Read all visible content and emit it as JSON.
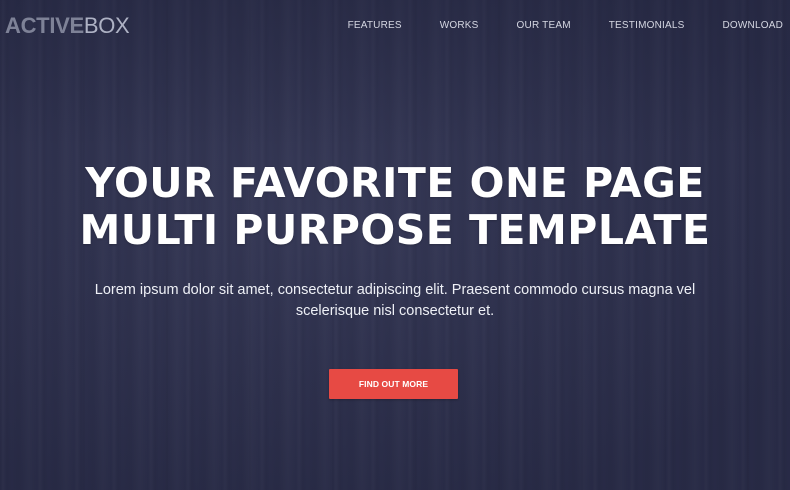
{
  "brand": {
    "logo_strong": "ACTIVE",
    "logo_light": "BOX"
  },
  "nav": {
    "items": [
      {
        "label": "FEATURES"
      },
      {
        "label": "WORKS"
      },
      {
        "label": "OUR TEAM"
      },
      {
        "label": "TESTIMONIALS"
      },
      {
        "label": "DOWNLOAD"
      }
    ]
  },
  "hero": {
    "title_line1": "YOUR FAVORITE ONE PAGE",
    "title_line2": "MULTI PURPOSE TEMPLATE",
    "subtitle": "Lorem ipsum dolor sit amet, consectetur adipiscing elit. Praesent commodo cursus magna vel scelerisque nisl consectetur et.",
    "cta_label": "FIND OUT MORE"
  },
  "colors": {
    "background": "#2e3150",
    "accent": "#e74a44",
    "text": "#ffffff"
  }
}
